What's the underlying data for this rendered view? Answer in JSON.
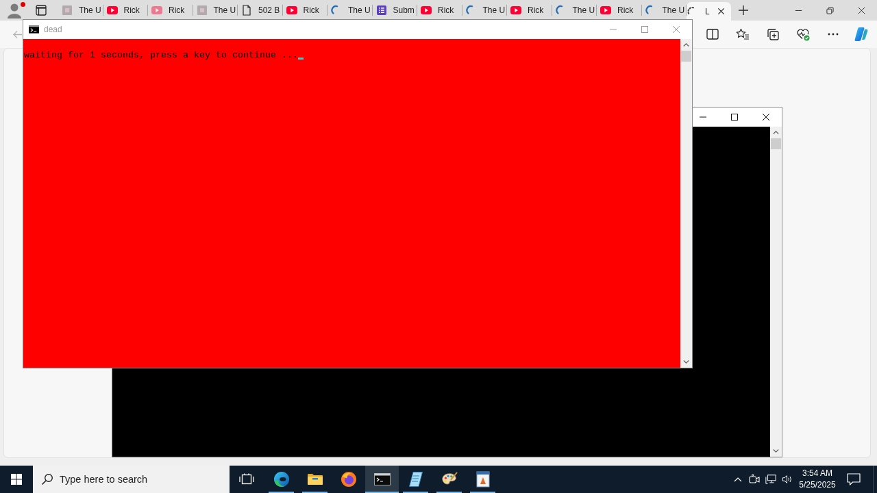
{
  "browser": {
    "profile": {
      "alert": true
    },
    "tabs": [
      {
        "kind": "page",
        "sleeping": true,
        "label": "The U",
        "selected": false
      },
      {
        "kind": "video",
        "sleeping": false,
        "label": "Rick",
        "selected": false
      },
      {
        "kind": "video",
        "sleeping": true,
        "label": "Rick",
        "selected": false
      },
      {
        "kind": "page",
        "sleeping": true,
        "label": "The U",
        "selected": false
      },
      {
        "kind": "document",
        "sleeping": false,
        "label": "502 B",
        "selected": false
      },
      {
        "kind": "video",
        "sleeping": false,
        "label": "Rick",
        "selected": false
      },
      {
        "kind": "loading",
        "sleeping": false,
        "label": "The U",
        "selected": false
      },
      {
        "kind": "form",
        "sleeping": false,
        "label": "Subm",
        "selected": false
      },
      {
        "kind": "video",
        "sleeping": false,
        "label": "Rick",
        "selected": false
      },
      {
        "kind": "loading",
        "sleeping": false,
        "label": "The U",
        "selected": false
      },
      {
        "kind": "video",
        "sleeping": false,
        "label": "Rick",
        "selected": false
      },
      {
        "kind": "loading",
        "sleeping": false,
        "label": "The U",
        "selected": false
      },
      {
        "kind": "video",
        "sleeping": false,
        "label": "Rick",
        "selected": false
      },
      {
        "kind": "loading",
        "sleeping": false,
        "label": "The U",
        "selected": false
      },
      {
        "kind": "loading",
        "sleeping": false,
        "label": "L",
        "selected": true
      }
    ],
    "back_button": {
      "disabled": true
    }
  },
  "consoles": [
    {
      "title": "dead",
      "active": false,
      "color": "#ff0000",
      "lines": [
        "waiting for 1 seconds, press a key to continue ..."
      ],
      "cursor": true
    },
    {
      "active": true,
      "color": "#000000"
    }
  ],
  "taskbar": {
    "search": {
      "placeholder": "Type here to search"
    },
    "apps": [
      {
        "kind": "swirl",
        "running": true,
        "selected": false
      },
      {
        "kind": "folder",
        "running": true,
        "selected": false
      },
      {
        "kind": "globe",
        "running": false,
        "selected": false
      },
      {
        "kind": "terminal",
        "running": true,
        "selected": true
      },
      {
        "kind": "notepad",
        "running": true,
        "selected": false
      },
      {
        "kind": "palette",
        "running": true,
        "selected": false
      },
      {
        "kind": "document",
        "running": true,
        "selected": false
      }
    ],
    "clock": {
      "time": "3:54 AM",
      "date": "5/25/2025"
    }
  }
}
